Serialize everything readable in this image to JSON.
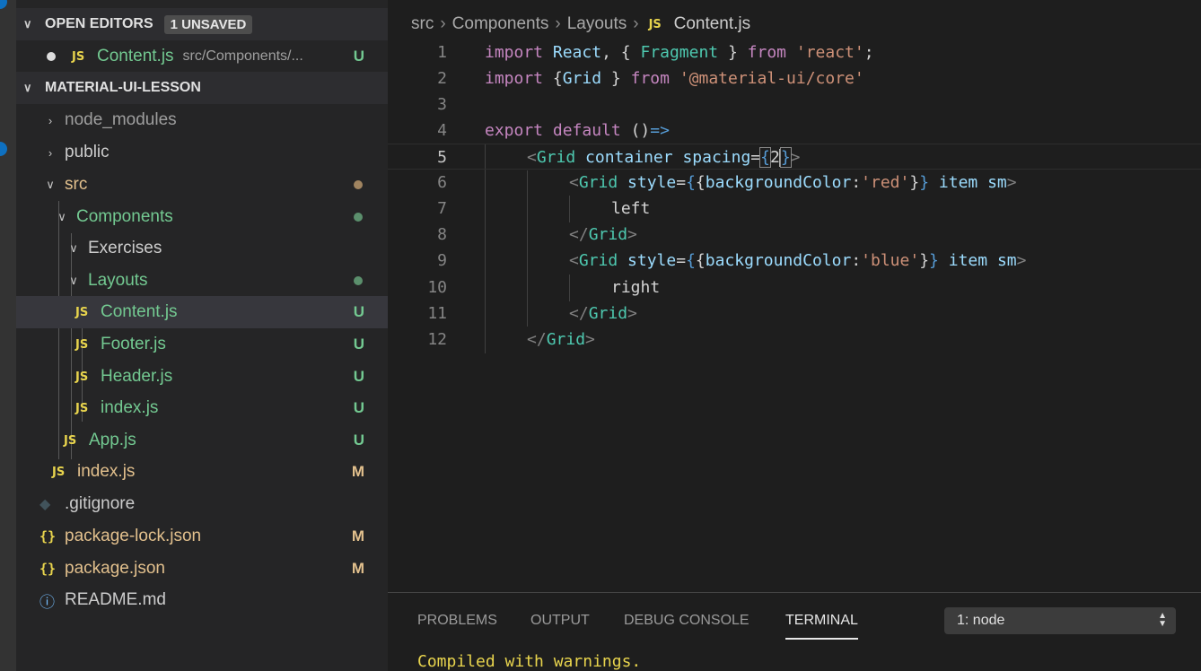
{
  "sidebar": {
    "open_editors": {
      "title": "OPEN EDITORS",
      "badge": "1 UNSAVED",
      "file": {
        "name": "Content.js",
        "path": "src/Components/...",
        "status": "U"
      }
    },
    "project": {
      "title": "MATERIAL-UI-LESSON"
    },
    "tree": [
      {
        "label": "node_modules",
        "status": ""
      },
      {
        "label": "public",
        "status": ""
      },
      {
        "label": "src",
        "status": ""
      },
      {
        "label": "Components",
        "status": ""
      },
      {
        "label": "Exercises",
        "status": ""
      },
      {
        "label": "Layouts",
        "status": ""
      },
      {
        "label": "Content.js",
        "status": "U"
      },
      {
        "label": "Footer.js",
        "status": "U"
      },
      {
        "label": "Header.js",
        "status": "U"
      },
      {
        "label": "index.js",
        "status": "U"
      },
      {
        "label": "App.js",
        "status": "U"
      },
      {
        "label": "index.js",
        "status": "M"
      },
      {
        "label": ".gitignore",
        "status": ""
      },
      {
        "label": "package-lock.json",
        "status": "M"
      },
      {
        "label": "package.json",
        "status": "M"
      },
      {
        "label": "README.md",
        "status": ""
      }
    ],
    "icons": {
      "js": "JS",
      "json": "{}"
    }
  },
  "editor": {
    "breadcrumb": [
      "src",
      "Components",
      "Layouts",
      "Content.js"
    ],
    "line_numbers": [
      "1",
      "2",
      "3",
      "4",
      "5",
      "6",
      "7",
      "8",
      "9",
      "10",
      "11",
      "12"
    ],
    "code": {
      "l1": {
        "import": "import",
        "react": "React",
        "brace_open": "{",
        "fragment": "Fragment",
        "brace_close": "}",
        "from": "from",
        "module": "'react'",
        "end": ";"
      },
      "l2": {
        "import": "import",
        "brace_open": "{",
        "grid": "Grid",
        "brace_close": "}",
        "from": "from",
        "module": "'@material-ui/core'"
      },
      "l4": {
        "export": "export",
        "default": "default",
        "parens": "()",
        "arrow": "=>"
      },
      "l5": {
        "tag": "Grid",
        "attr1": "container",
        "attr2": "spacing",
        "value": "2"
      },
      "l6": {
        "tag": "Grid",
        "attr": "style",
        "prop": "backgroundColor",
        "color": "'red'",
        "attr2": "item",
        "attr3": "sm"
      },
      "l7": {
        "text": "left"
      },
      "l8": {
        "tag": "Grid"
      },
      "l9": {
        "tag": "Grid",
        "attr": "style",
        "prop": "backgroundColor",
        "color": "'blue'",
        "attr2": "item",
        "attr3": "sm"
      },
      "l10": {
        "text": "right"
      },
      "l11": {
        "tag": "Grid"
      },
      "l12": {
        "tag": "Grid"
      }
    }
  },
  "panel": {
    "tabs": [
      "PROBLEMS",
      "OUTPUT",
      "DEBUG CONSOLE",
      "TERMINAL"
    ],
    "active_tab": "TERMINAL",
    "terminal_select": "1: node",
    "output": "Compiled with warnings."
  },
  "colors": {
    "untracked": "#73c991",
    "modified": "#e2c08d",
    "accent": "#0e70c0"
  }
}
